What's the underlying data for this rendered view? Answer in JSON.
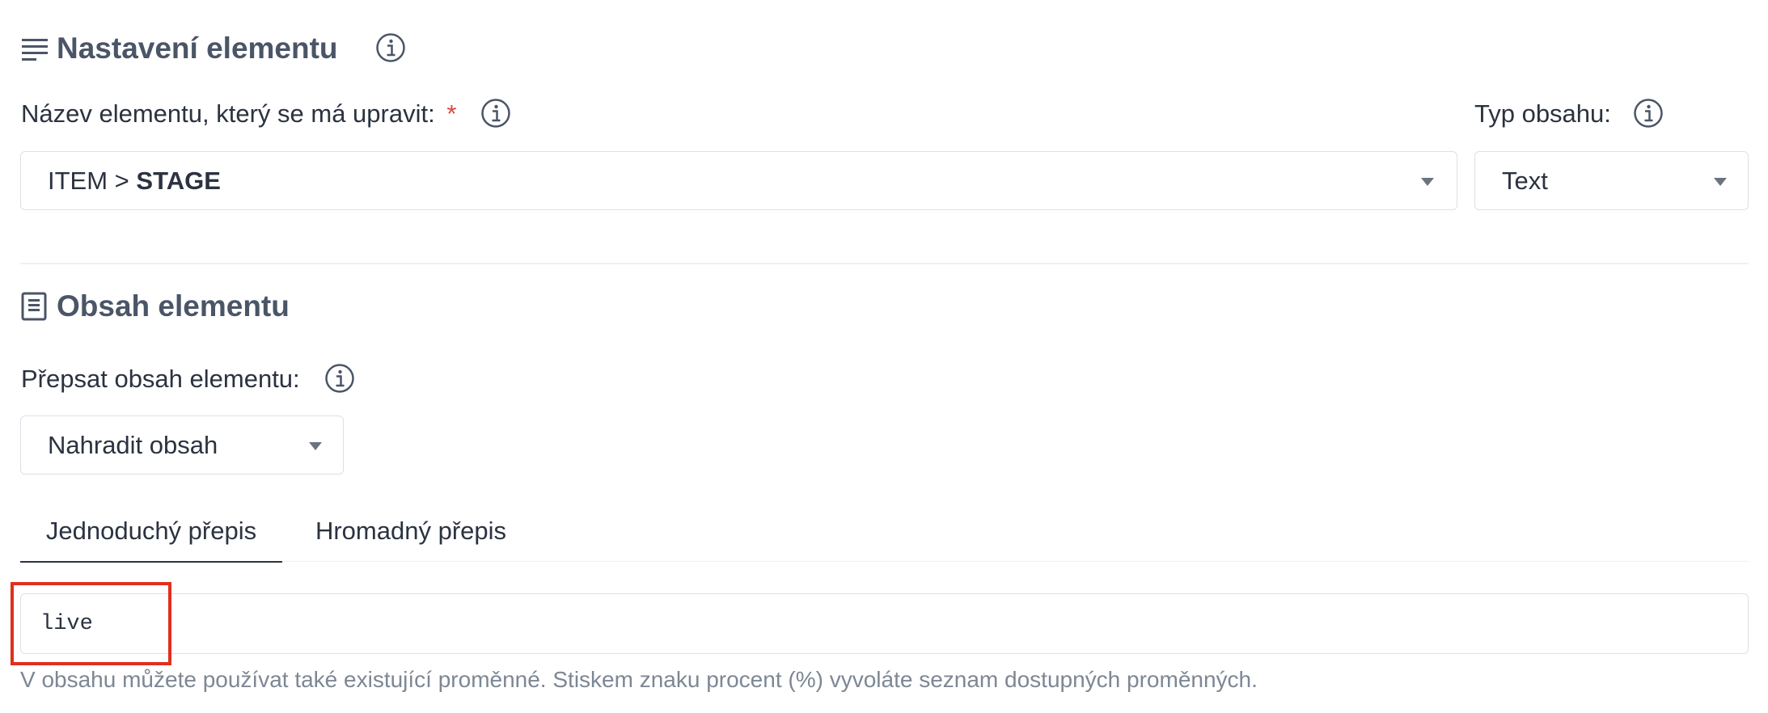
{
  "settings_section": {
    "title": "Nastavení elementu",
    "icon": "lines-icon"
  },
  "element_name": {
    "label": "Název elementu, který se má upravit:",
    "required_mark": "*",
    "value_prefix": "ITEM > ",
    "value_bold": "STAGE"
  },
  "content_type": {
    "label": "Typ obsahu:",
    "value": "Text"
  },
  "content_section": {
    "title": "Obsah elementu",
    "icon": "document-icon"
  },
  "overwrite": {
    "label": "Přepsat obsah elementu:",
    "value": "Nahradit obsah"
  },
  "tabs": [
    {
      "label": "Jednoduchý přepis",
      "active": true
    },
    {
      "label": "Hromadný přepis",
      "active": false
    }
  ],
  "content_input": {
    "value": "live"
  },
  "hint": "V obsahu můžete používat také existující proměnné. Stiskem znaku procent (%) vyvoláte seznam dostupných proměnných.",
  "colors": {
    "accent_required": "#e0443e",
    "highlight_box": "#e0301e",
    "title_text": "#4a5567",
    "hint_text": "#7d8794",
    "border": "#dbe1e7"
  }
}
